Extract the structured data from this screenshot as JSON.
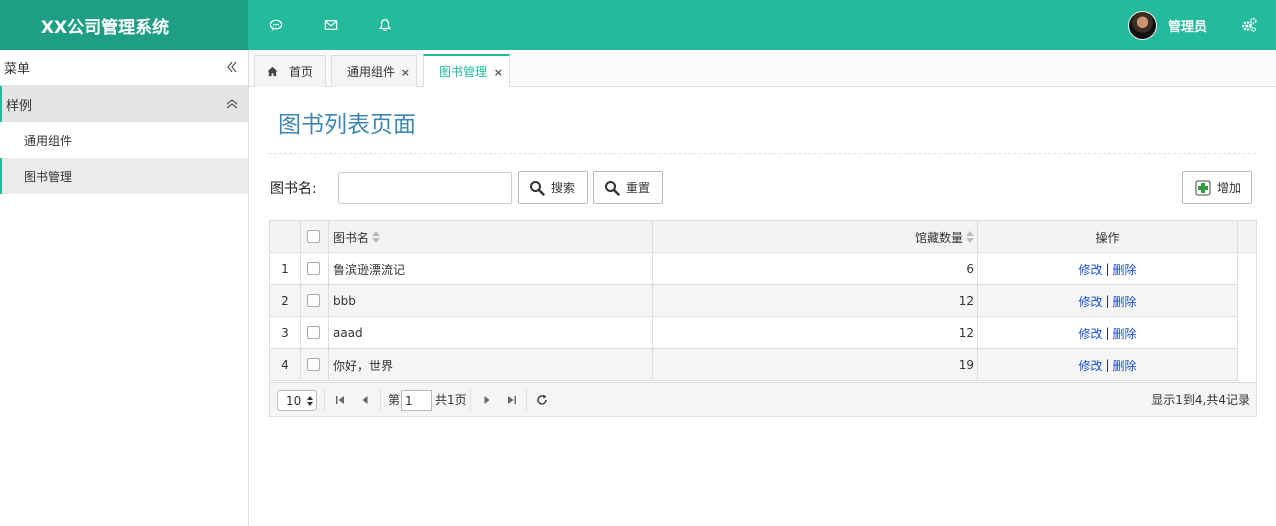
{
  "app": {
    "title": "XX公司管理系统"
  },
  "header": {
    "icons": [
      "chat-icon",
      "mail-icon",
      "bell-icon"
    ],
    "user": "管理员",
    "settings_icon": "gears-icon"
  },
  "sidebar": {
    "title": "菜单",
    "group": "样例",
    "items": [
      {
        "label": "通用组件"
      },
      {
        "label": "图书管理"
      }
    ]
  },
  "tabs": [
    {
      "label": "首页"
    },
    {
      "label": "通用组件",
      "close": "×"
    },
    {
      "label": "图书管理",
      "close": "×"
    }
  ],
  "page": {
    "title": "图书列表页面",
    "search_label": "图书名:",
    "search_value": "",
    "search_btn": "搜索",
    "reset_btn": "重置",
    "add_btn": "增加"
  },
  "table": {
    "columns": [
      "图书名",
      "馆藏数量",
      "操作"
    ],
    "rows": [
      {
        "num": "1",
        "name": "鲁滨逊漂流记",
        "qty": "6",
        "edit": "修改",
        "sep": "|",
        "del": "删除"
      },
      {
        "num": "2",
        "name": "bbb",
        "qty": "12",
        "edit": "修改",
        "sep": "|",
        "del": "删除"
      },
      {
        "num": "3",
        "name": "aaad",
        "qty": "12",
        "edit": "修改",
        "sep": "|",
        "del": "删除"
      },
      {
        "num": "4",
        "name": "你好，世界",
        "qty": "19",
        "edit": "修改",
        "sep": "|",
        "del": "删除"
      }
    ]
  },
  "pager": {
    "page_size": "10",
    "page_prefix": "第",
    "page_value": "1",
    "page_suffix": "共1页",
    "summary": "显示1到4,共4记录"
  },
  "colors": {
    "brand": "#23bb9c",
    "logo_bg": "#1e9f85",
    "title": "#3f87b3",
    "link": "#1d4fd6"
  }
}
